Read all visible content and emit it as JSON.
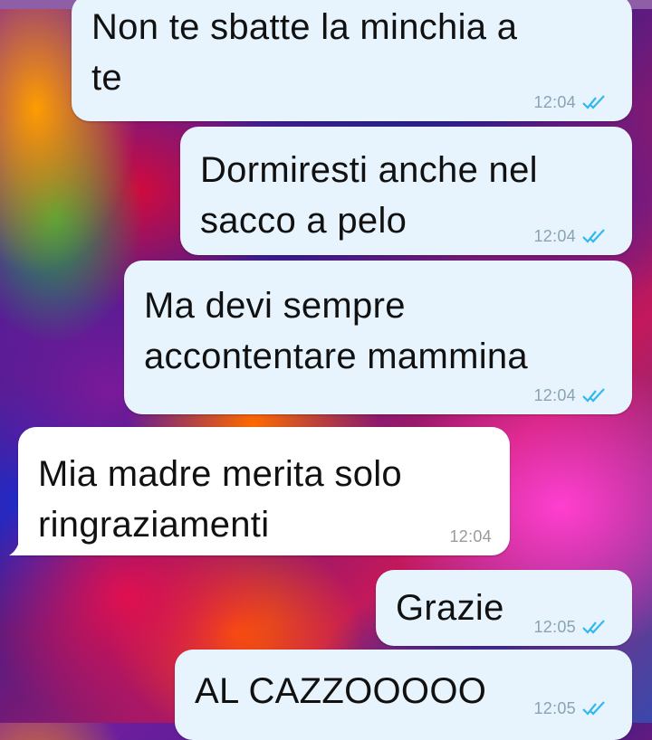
{
  "colors": {
    "outgoing_bubble": "#e7f4fd",
    "incoming_bubble": "#ffffff",
    "read_ticks": "#34b7f1",
    "timestamp": "#8aa3b3"
  },
  "messages": [
    {
      "direction": "outgoing",
      "text_line1": "Non te sbatte la minchia a",
      "text_line2": "te",
      "time": "12:04",
      "status": "read-double-check-icon"
    },
    {
      "direction": "outgoing",
      "text_line1": "Dormiresti anche nel",
      "text_line2": "sacco a pelo",
      "time": "12:04",
      "status": "read-double-check-icon"
    },
    {
      "direction": "outgoing",
      "text_line1": "Ma devi sempre",
      "text_line2": "accontentare mammina",
      "time": "12:04",
      "status": "read-double-check-icon"
    },
    {
      "direction": "incoming",
      "text_line1": "Mia madre merita solo",
      "text_line2": "ringraziamenti",
      "time": "12:04"
    },
    {
      "direction": "outgoing",
      "text_line1": "Grazie",
      "time": "12:05",
      "status": "read-double-check-icon"
    },
    {
      "direction": "outgoing",
      "text_line1": "AL CAZZOOOOO",
      "time": "12:05",
      "status": "read-double-check-icon"
    }
  ]
}
